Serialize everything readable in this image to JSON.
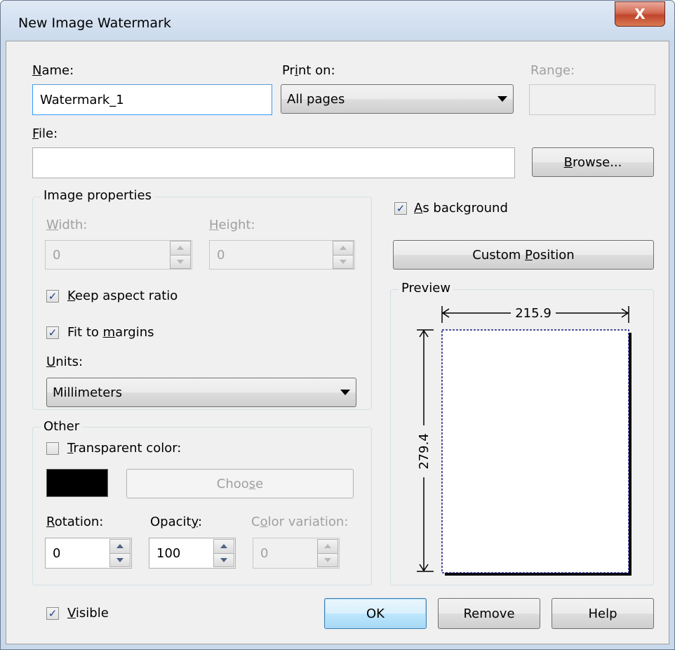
{
  "window": {
    "title": "New Image Watermark",
    "close_glyph": "X"
  },
  "name": {
    "label_u": "N",
    "label_rest": "ame:",
    "value": "Watermark_1"
  },
  "print_on": {
    "label_pre": "Pr",
    "label_u": "i",
    "label_rest": "nt on:",
    "value": "All pages"
  },
  "range": {
    "label_pre": "Ran",
    "label_u": "g",
    "label_rest": "e:",
    "value": ""
  },
  "file": {
    "label_u": "F",
    "label_rest": "ile:",
    "value": "",
    "browse_u": "B",
    "browse_rest": "rowse..."
  },
  "image_properties": {
    "title": "Image properties",
    "width_label_u": "W",
    "width_label_rest": "idth:",
    "width_value": "0",
    "height_label_u": "H",
    "height_label_rest": "eight:",
    "height_value": "0",
    "keep_aspect_u": "K",
    "keep_aspect_rest": "eep aspect ratio",
    "keep_aspect_checked": true,
    "fit_pre": "Fit to ",
    "fit_u": "m",
    "fit_rest": "argins",
    "fit_checked": true,
    "units_label_u": "U",
    "units_label_rest": "nits:",
    "units_value": "Millimeters"
  },
  "as_background": {
    "label_u": "A",
    "label_rest": "s background",
    "checked": true
  },
  "custom_position": {
    "label_pre": "Custom ",
    "label_u": "P",
    "label_rest": "osition"
  },
  "preview": {
    "title": "Preview",
    "width_dim": "215.9",
    "height_dim": "279.4"
  },
  "other": {
    "title": "Other",
    "transparent_u": "T",
    "transparent_rest": "ransparent color:",
    "transparent_checked": false,
    "swatch_color": "#000000",
    "choose_pre": "Choo",
    "choose_u": "s",
    "choose_rest": "e",
    "rotation_u": "R",
    "rotation_rest": "otation:",
    "rotation_value": "0",
    "opacity_pre": "Opacit",
    "opacity_u": "y",
    "opacity_rest": ":",
    "opacity_value": "100",
    "colorvar_pre": "C",
    "colorvar_u": "o",
    "colorvar_rest": "lor variation:",
    "colorvar_value": "0"
  },
  "visible": {
    "label_u": "V",
    "label_rest": "isible",
    "checked": true
  },
  "buttons": {
    "ok": "OK",
    "remove": "Remove",
    "help": "Help"
  }
}
